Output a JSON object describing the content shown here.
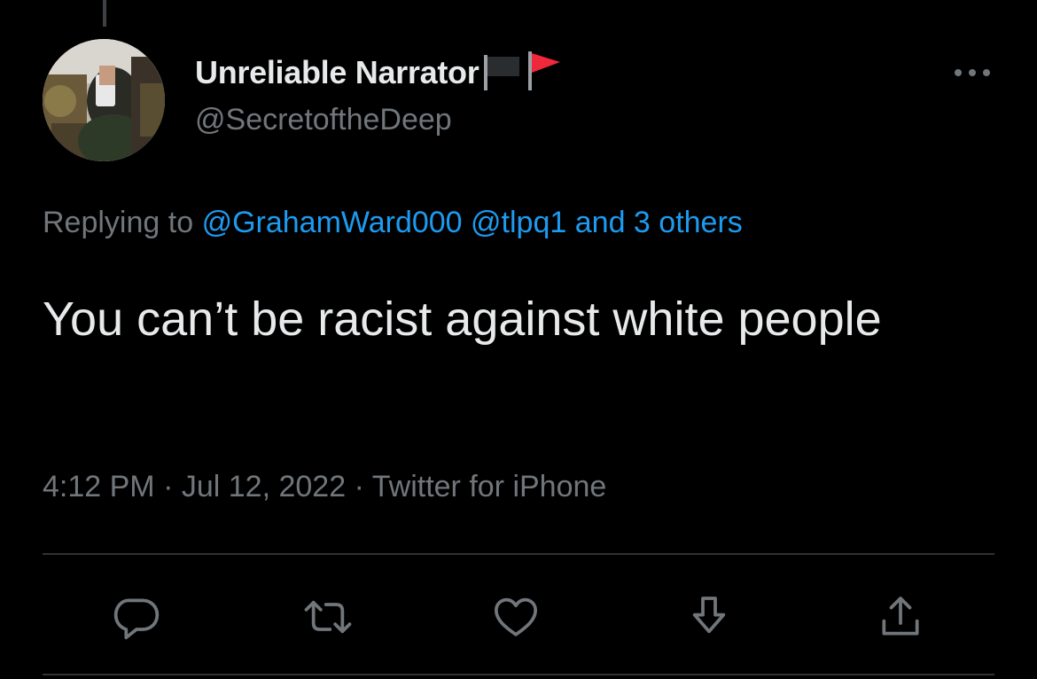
{
  "tweet": {
    "author": {
      "display_name": "Unreliable Narrator",
      "handle": "@SecretoftheDeep",
      "flags": [
        "black-flag-icon",
        "red-flag-icon"
      ]
    },
    "replying": {
      "prefix": "Replying to",
      "mentions": [
        "@GrahamWard000",
        "@tlpq1"
      ],
      "others": "and 3 others"
    },
    "text": "You can’t be racist against white people",
    "meta": {
      "time": "4:12 PM",
      "date": "Jul 12, 2022",
      "source": "Twitter for iPhone",
      "separator": "·"
    },
    "actions": [
      "reply-icon",
      "retweet-icon",
      "like-icon",
      "bookmark-icon",
      "share-icon"
    ]
  },
  "colors": {
    "background": "#000000",
    "text": "#e7e9ea",
    "secondary": "#71767b",
    "link": "#1d9bf0",
    "divider": "#2f3336",
    "red_flag": "#f91880"
  }
}
